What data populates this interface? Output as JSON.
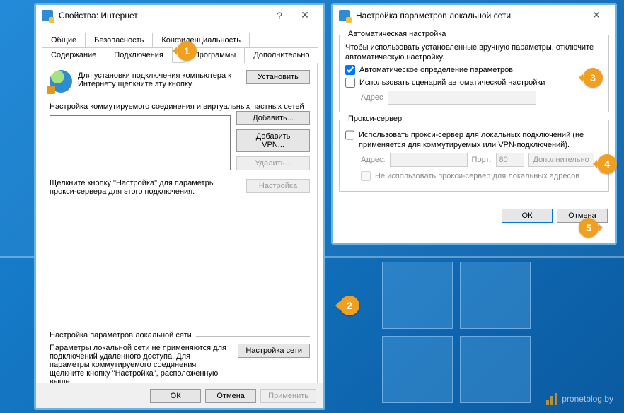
{
  "watermark": "pronetblog.by",
  "markers": {
    "m1": "1",
    "m2": "2",
    "m3": "3",
    "m4": "4",
    "m5": "5"
  },
  "dlg1": {
    "title": "Свойства: Интернет",
    "help": "?",
    "close": "✕",
    "tabs": {
      "row1": [
        "Общие",
        "Безопасность",
        "Конфиденциальность"
      ],
      "row2": [
        "Содержание",
        "Подключения",
        "Программы",
        "Дополнительно"
      ],
      "active": "Подключения"
    },
    "intro_text": "Для установки подключения компьютера к Интернету щелкните эту кнопку.",
    "install_btn": "Установить",
    "dial_group_title": "Настройка коммутируемого соединения и виртуальных частных сетей",
    "add_btn": "Добавить...",
    "add_vpn_btn": "Добавить VPN...",
    "delete_btn": "Удалить...",
    "proxy_hint": "Щелкните кнопку \"Настройка\" для параметры прокси-сервера для этого подключения.",
    "settings_btn": "Настройка",
    "lan_group_title": "Настройка параметров локальной сети",
    "lan_text": "Параметры локальной сети не применяются для подключений удаленного доступа. Для параметры коммутируемого соединения щелкните кнопку \"Настройка\", расположенную выше.",
    "lan_btn": "Настройка сети",
    "ok": "ОК",
    "cancel": "Отмена",
    "apply": "Применить"
  },
  "dlg2": {
    "title": "Настройка параметров локальной сети",
    "close": "✕",
    "auto_group": "Автоматическая настройка",
    "auto_text": "Чтобы использовать установленные вручную параметры, отключите автоматическую настройку.",
    "auto_detect": "Автоматическое определение параметров",
    "use_script": "Использовать сценарий автоматической настройки",
    "addr_label": "Адрес",
    "addr_value": "",
    "proxy_group": "Прокси-сервер",
    "proxy_use": "Использовать прокси-сервер для локальных подключений (не применяется для коммутируемых или VPN-подключений).",
    "proxy_addr_label": "Адрес:",
    "proxy_addr_value": "",
    "proxy_port_label": "Порт:",
    "proxy_port_value": "80",
    "advanced_btn": "Дополнительно",
    "bypass_local": "Не использовать прокси-сервер для локальных адресов",
    "ok": "ОК",
    "cancel": "Отмена"
  },
  "auto_detect_checked": true,
  "use_script_checked": false,
  "proxy_use_checked": false,
  "bypass_local_checked": false
}
